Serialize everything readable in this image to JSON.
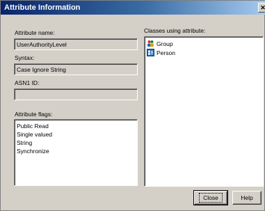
{
  "window": {
    "title": "Attribute Information",
    "close_glyph": "✕"
  },
  "labels": {
    "attribute_name": "Attribute name:",
    "syntax": "Syntax:",
    "asn1_id": "ASN1 ID:",
    "attribute_flags": "Attribute flags:",
    "classes_using": "Classes using attribute:"
  },
  "fields": {
    "attribute_name": "UserAuthorityLevel",
    "syntax": "Case Ignore String",
    "asn1_id": ""
  },
  "attribute_flags": [
    "Public Read",
    "Single valued",
    "String",
    "Synchronize"
  ],
  "classes": [
    {
      "name": "Group",
      "icon": "group-icon"
    },
    {
      "name": "Person",
      "icon": "person-icon"
    }
  ],
  "buttons": {
    "close": "Close",
    "help": "Help"
  },
  "colors": {
    "titlebar_start": "#0a246a",
    "titlebar_end": "#a6caf0",
    "dialog_bg": "#d4d0c8"
  }
}
